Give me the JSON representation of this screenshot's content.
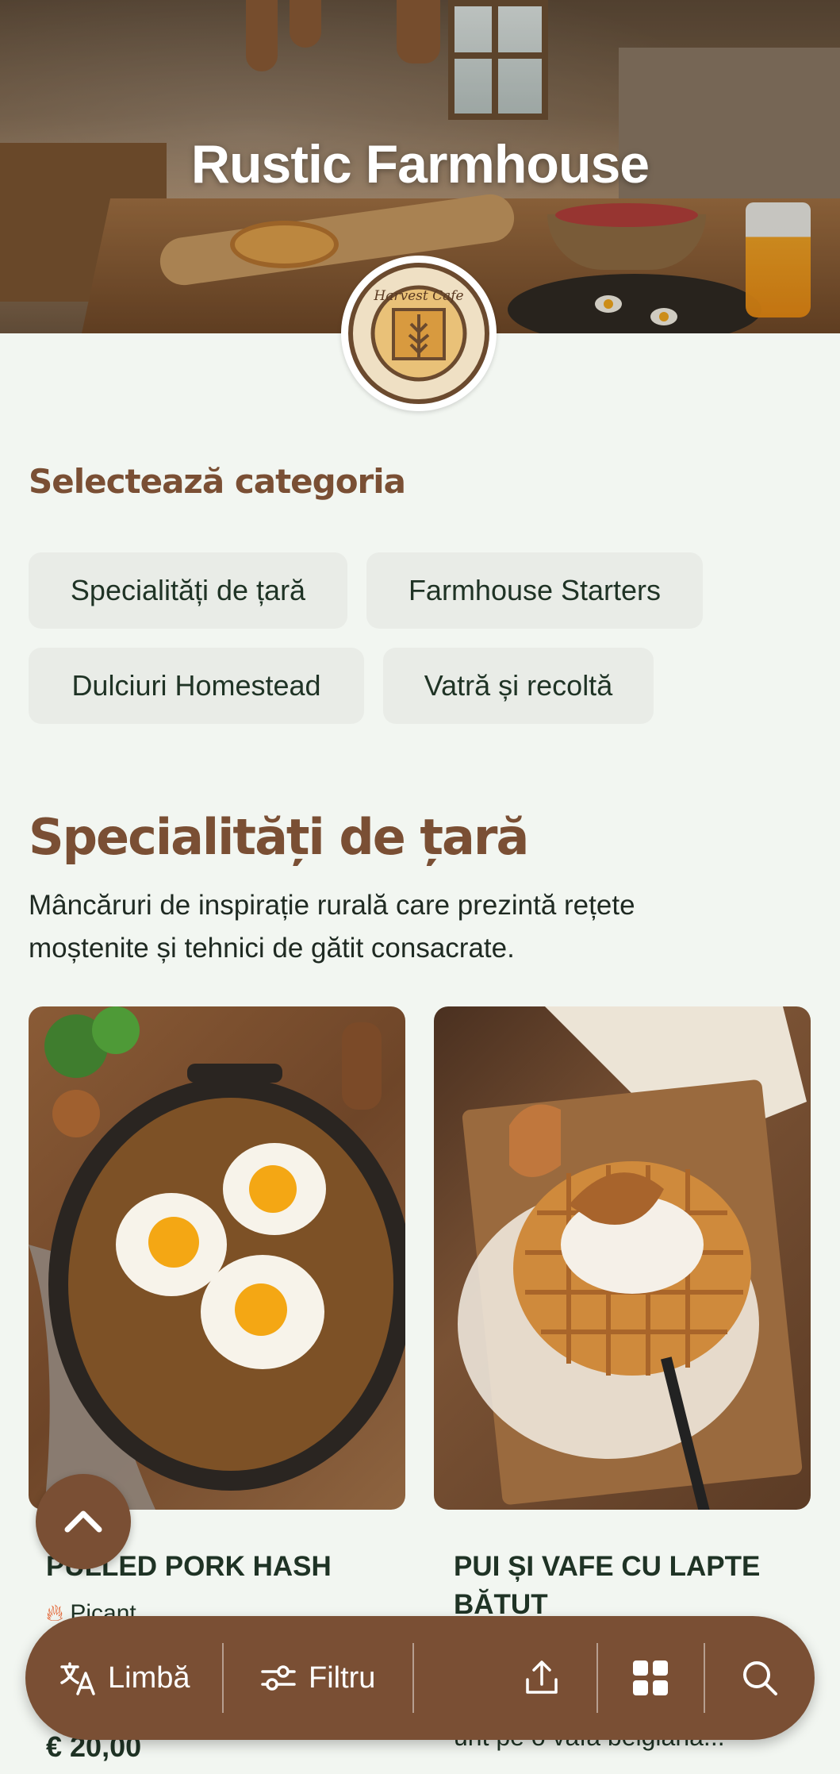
{
  "hero": {
    "title": "Rustic Farmhouse",
    "logo_text": "Harvest Cafe"
  },
  "categories": {
    "heading": "Selectează categoria",
    "chips": [
      "Specialități de țară",
      "Farmhouse Starters",
      "Dulciuri Homestead",
      "Vatră și recoltă"
    ]
  },
  "section": {
    "title": "Specialități de țară",
    "description_line1": "Mâncăruri de inspirație rurală care prezintă rețete",
    "description_line2": "moștenite și tehnici de gătit consacrate."
  },
  "items": [
    {
      "name": "PULLED PORK HASH",
      "tag": "Picant",
      "price": "€ 20,00"
    },
    {
      "name_line1": "PUI ȘI VAFE CU LAPTE",
      "name_line2": "BĂTUT",
      "desc_peek": "unt pe o vafă belgiană..."
    }
  ],
  "bottom_bar": {
    "language": "Limbă",
    "filter": "Filtru"
  },
  "colors": {
    "accent": "#7a4f34",
    "background": "#f2f6f1",
    "chip": "#e9ece7"
  }
}
